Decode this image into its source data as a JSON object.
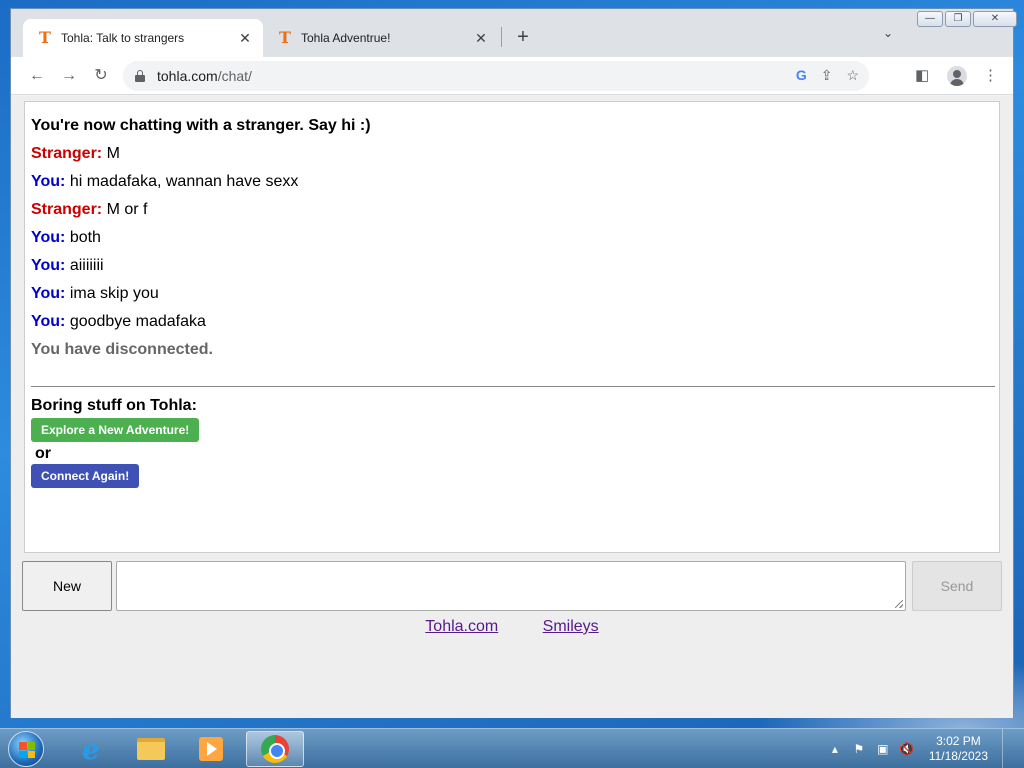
{
  "browser": {
    "tabs": [
      {
        "title": "Tohla: Talk to strangers",
        "favicon": "T",
        "active": true
      },
      {
        "title": "Tohla Adventrue!",
        "favicon": "T",
        "active": false
      }
    ],
    "url_domain": "tohla.com",
    "url_path": "/chat/",
    "window_controls": {
      "minimize": "—",
      "restore": "❐",
      "close": "✕"
    }
  },
  "chat": {
    "status": "You're now chatting with a stranger. Say hi :)",
    "messages": [
      {
        "sender": "Stranger:",
        "text": "M"
      },
      {
        "sender": "You:",
        "text": "hi madafaka, wannan have sexx"
      },
      {
        "sender": "Stranger:",
        "text": "M or f"
      },
      {
        "sender": "You:",
        "text": "both"
      },
      {
        "sender": "You:",
        "text": "aiiiiiii"
      },
      {
        "sender": "You:",
        "text": "ima skip you"
      },
      {
        "sender": "You:",
        "text": "goodbye madafaka"
      }
    ],
    "disconnected": "You have disconnected.",
    "boring_heading": "Boring stuff on Tohla:",
    "explore_button": "Explore a New Adventure!",
    "or_text": "or",
    "connect_button": "Connect Again!"
  },
  "controls": {
    "new_button": "New",
    "message_value": "",
    "send_button": "Send"
  },
  "footer": {
    "links": [
      "Tohla.com",
      "Smileys"
    ]
  },
  "taskbar": {
    "time": "3:02 PM",
    "date": "11/18/2023"
  },
  "colors": {
    "stranger": "#cc0000",
    "you": "#0000cc",
    "explore_button": "#4caf50",
    "connect_button": "#3f51b5"
  }
}
